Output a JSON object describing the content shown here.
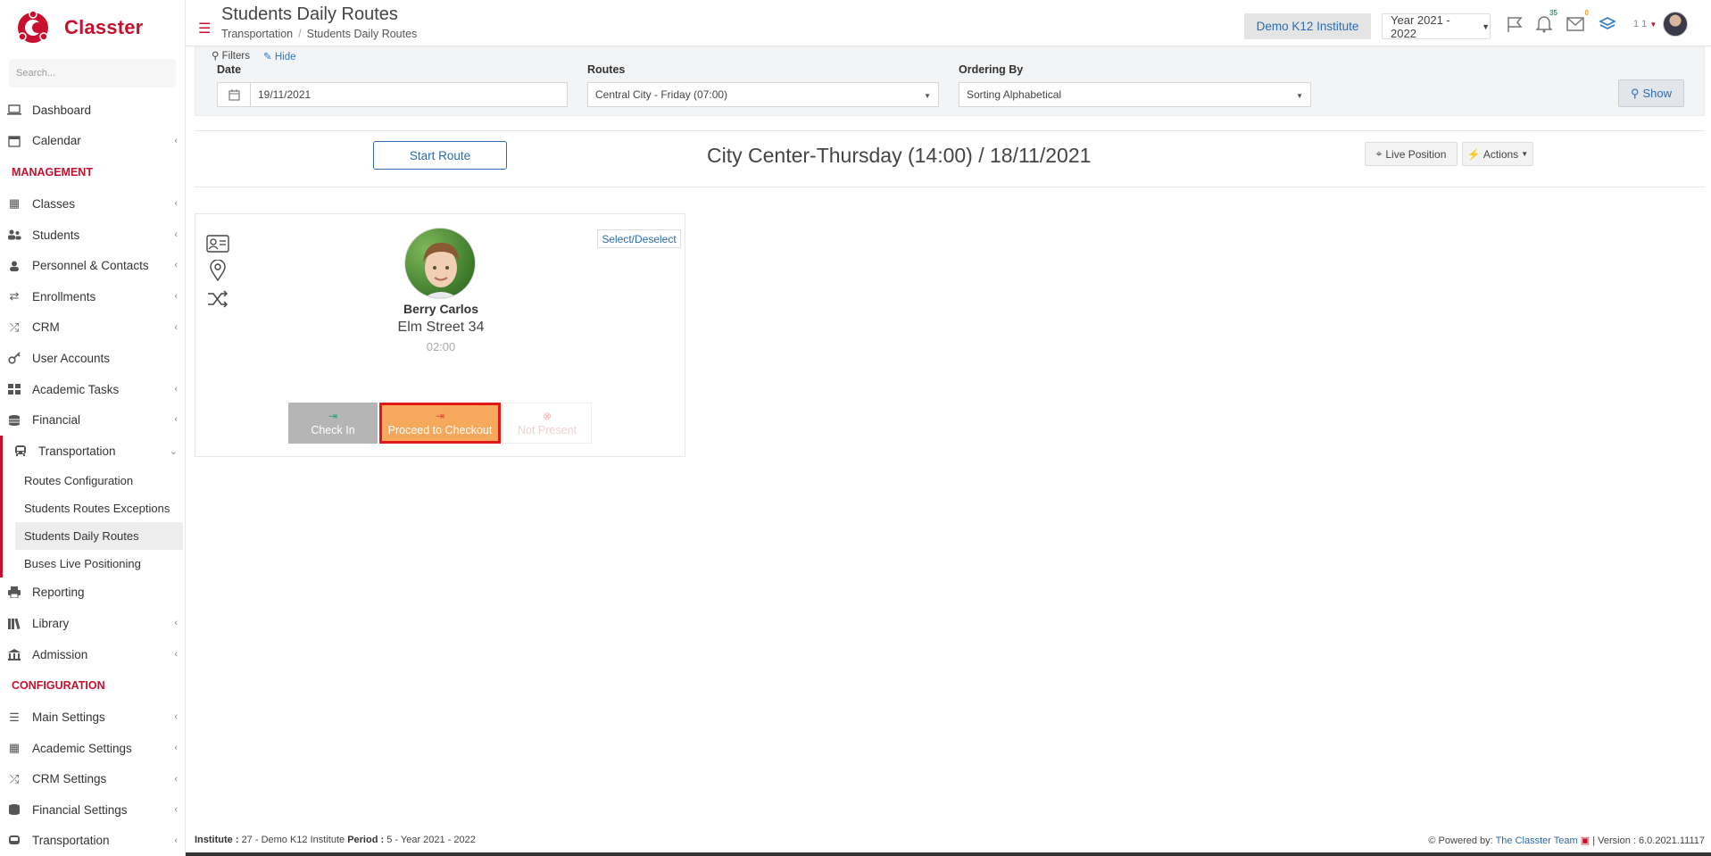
{
  "brand": {
    "name": "Classter",
    "color": "#c8102e"
  },
  "sidebar": {
    "search_placeholder": "Search...",
    "top_items": [
      {
        "label": "Dashboard",
        "icon": "laptop-icon"
      },
      {
        "label": "Calendar",
        "icon": "calendar-icon"
      }
    ],
    "management_label": "MANAGEMENT",
    "management_items": [
      {
        "label": "Classes",
        "icon": "classes-icon"
      },
      {
        "label": "Students",
        "icon": "students-icon"
      },
      {
        "label": "Personnel & Contacts",
        "icon": "person-icon"
      },
      {
        "label": "Enrollments",
        "icon": "arrows-icon"
      },
      {
        "label": "CRM",
        "icon": "shuffle-icon"
      },
      {
        "label": "User Accounts",
        "icon": "key-icon"
      },
      {
        "label": "Academic Tasks",
        "icon": "grid-icon"
      },
      {
        "label": "Financial",
        "icon": "coins-icon"
      }
    ],
    "transportation": {
      "label": "Transportation",
      "children": [
        "Routes Configuration",
        "Students Routes Exceptions",
        "Students Daily Routes",
        "Buses Live Positioning"
      ]
    },
    "bottom_items": [
      {
        "label": "Reporting",
        "icon": "printer-icon"
      },
      {
        "label": "Library",
        "icon": "books-icon"
      },
      {
        "label": "Admission",
        "icon": "building-icon"
      }
    ],
    "configuration_label": "CONFIGURATION",
    "configuration_items": [
      {
        "label": "Main Settings",
        "icon": "sliders-icon"
      },
      {
        "label": "Academic Settings",
        "icon": "classes-icon"
      },
      {
        "label": "CRM Settings",
        "icon": "shuffle-icon"
      },
      {
        "label": "Financial Settings",
        "icon": "coins-icon"
      },
      {
        "label": "Transportation",
        "icon": "bus-icon"
      }
    ]
  },
  "header": {
    "title": "Students Daily Routes",
    "breadcrumb": [
      "Transportation",
      "Students Daily Routes"
    ],
    "institute": "Demo K12 Institute",
    "year": "Year 2021 - 2022",
    "notifications": "35",
    "messages": "0",
    "user_count": "1 1"
  },
  "filters": {
    "toggle_label": "Filters",
    "hide_label": "Hide",
    "date_label": "Date",
    "date_value": "19/11/2021",
    "routes_label": "Routes",
    "routes_value": "Central City - Friday (07:00)",
    "ordering_label": "Ordering By",
    "ordering_value": "Sorting Alphabetical",
    "show_label": "Show"
  },
  "route": {
    "start_label": "Start Route",
    "title": "City Center-Thursday (14:00) / 18/11/2021",
    "live_label": "Live Position",
    "actions_label": "Actions"
  },
  "student": {
    "select_label": "Select/Deselect",
    "name": "Berry Carlos",
    "address": "Elm Street 34",
    "time": "02:00",
    "checkin_label": "Check In",
    "checkout_label": "Proceed to Checkout",
    "notpresent_label": "Not Present"
  },
  "footer": {
    "institute_label": "Institute :",
    "institute_value": "27 - Demo K12 Institute",
    "period_label": "Period :",
    "period_value": "5 - Year 2021 - 2022",
    "powered_label": "Powered by:",
    "powered_link": "The Classter Team",
    "version": "| Version : 6.0.2021.11117"
  }
}
